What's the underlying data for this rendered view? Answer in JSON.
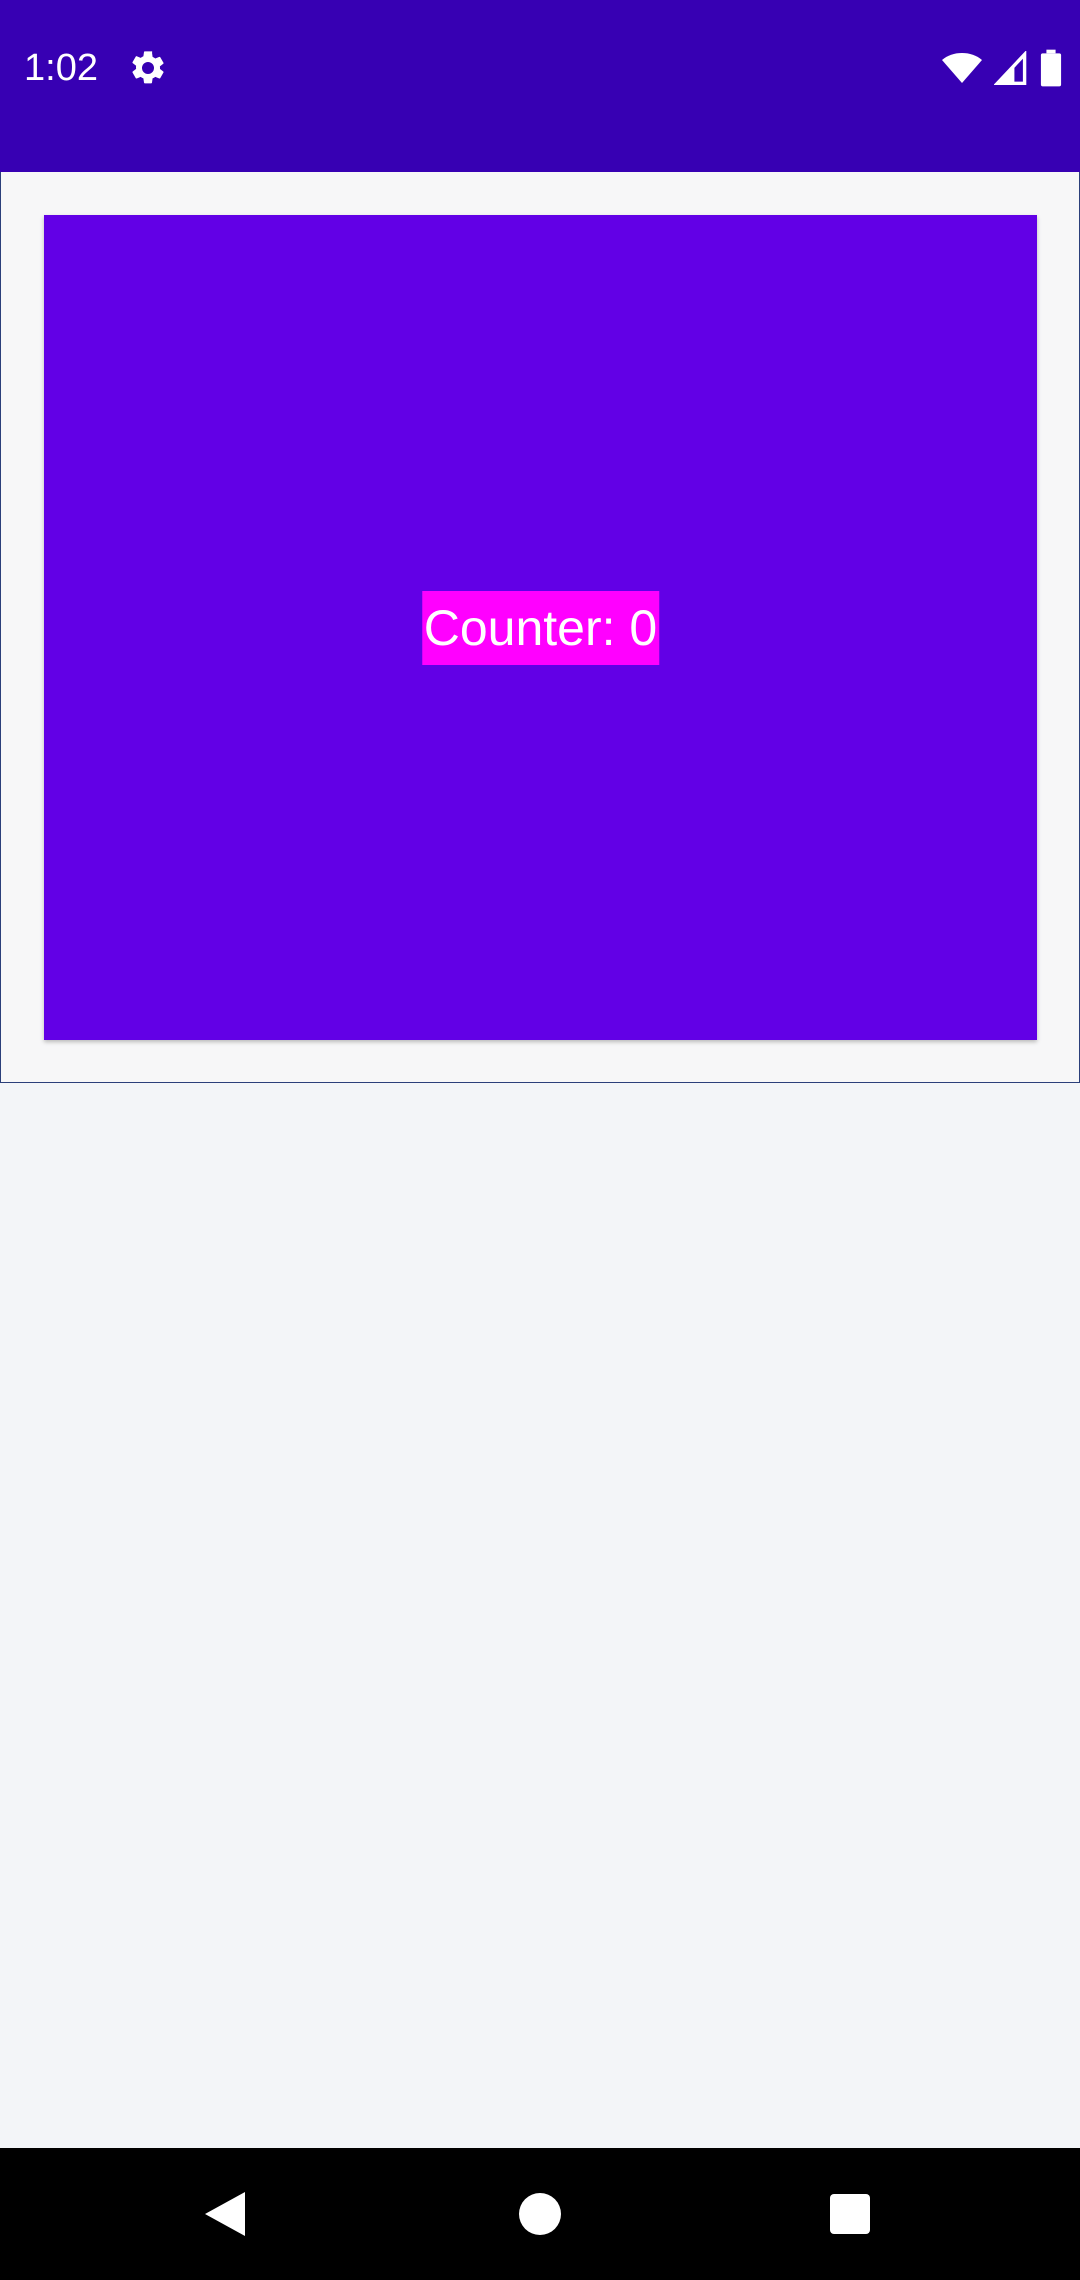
{
  "status_bar": {
    "time": "1:02",
    "icons": [
      "gear-icon",
      "wifi-icon",
      "signal-icon",
      "battery-icon"
    ],
    "background_color": "#3700b3"
  },
  "main": {
    "counter_text": "Counter: 0",
    "box_color": "#6200e6",
    "label_highlight_color": "#ff00ff"
  },
  "nav_bar": {
    "buttons": [
      "back-icon",
      "home-icon",
      "recents-icon"
    ]
  }
}
